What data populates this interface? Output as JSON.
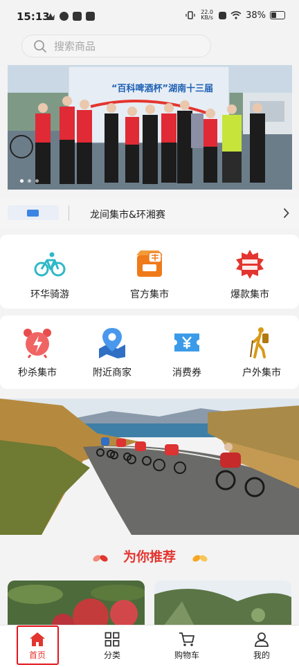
{
  "status_bar": {
    "time": "15:13",
    "net_speed": "22.0",
    "net_unit": "KB/s",
    "battery": "38%"
  },
  "search": {
    "placeholder": "搜索商品"
  },
  "banner": {
    "title": "“百科啤酒杯”湖南十三届",
    "slide_count": 3,
    "active_slide": 1
  },
  "notice": {
    "text": "龙间集市&环湘赛"
  },
  "categories_row1": [
    {
      "label": "环华骑游",
      "icon": "bicycle-icon",
      "color": "#2fb8c8"
    },
    {
      "label": "官方集市",
      "icon": "official-shop-icon",
      "color": "#ef7a1a"
    },
    {
      "label": "爆款集市",
      "icon": "hot-deal-badge-icon",
      "color": "#e3352f"
    }
  ],
  "categories_row2": [
    {
      "label": "秒杀集市",
      "icon": "alarm-clock-icon",
      "color": "#e94c4c"
    },
    {
      "label": "附近商家",
      "icon": "location-pin-icon",
      "color": "#3b84e3"
    },
    {
      "label": "消费券",
      "icon": "coupon-icon",
      "color": "#2f8fe0"
    },
    {
      "label": "户外集市",
      "icon": "hiker-icon",
      "color": "#d89a18"
    }
  ],
  "recommend": {
    "title": "为你推荐"
  },
  "nav": [
    {
      "label": "首页",
      "icon": "home-icon",
      "active": true
    },
    {
      "label": "分类",
      "icon": "category-grid-icon",
      "active": false
    },
    {
      "label": "购物车",
      "icon": "cart-icon",
      "active": false
    },
    {
      "label": "我的",
      "icon": "user-icon",
      "active": false
    }
  ],
  "colors": {
    "accent": "#e3352f",
    "background": "#f3f3f3"
  }
}
